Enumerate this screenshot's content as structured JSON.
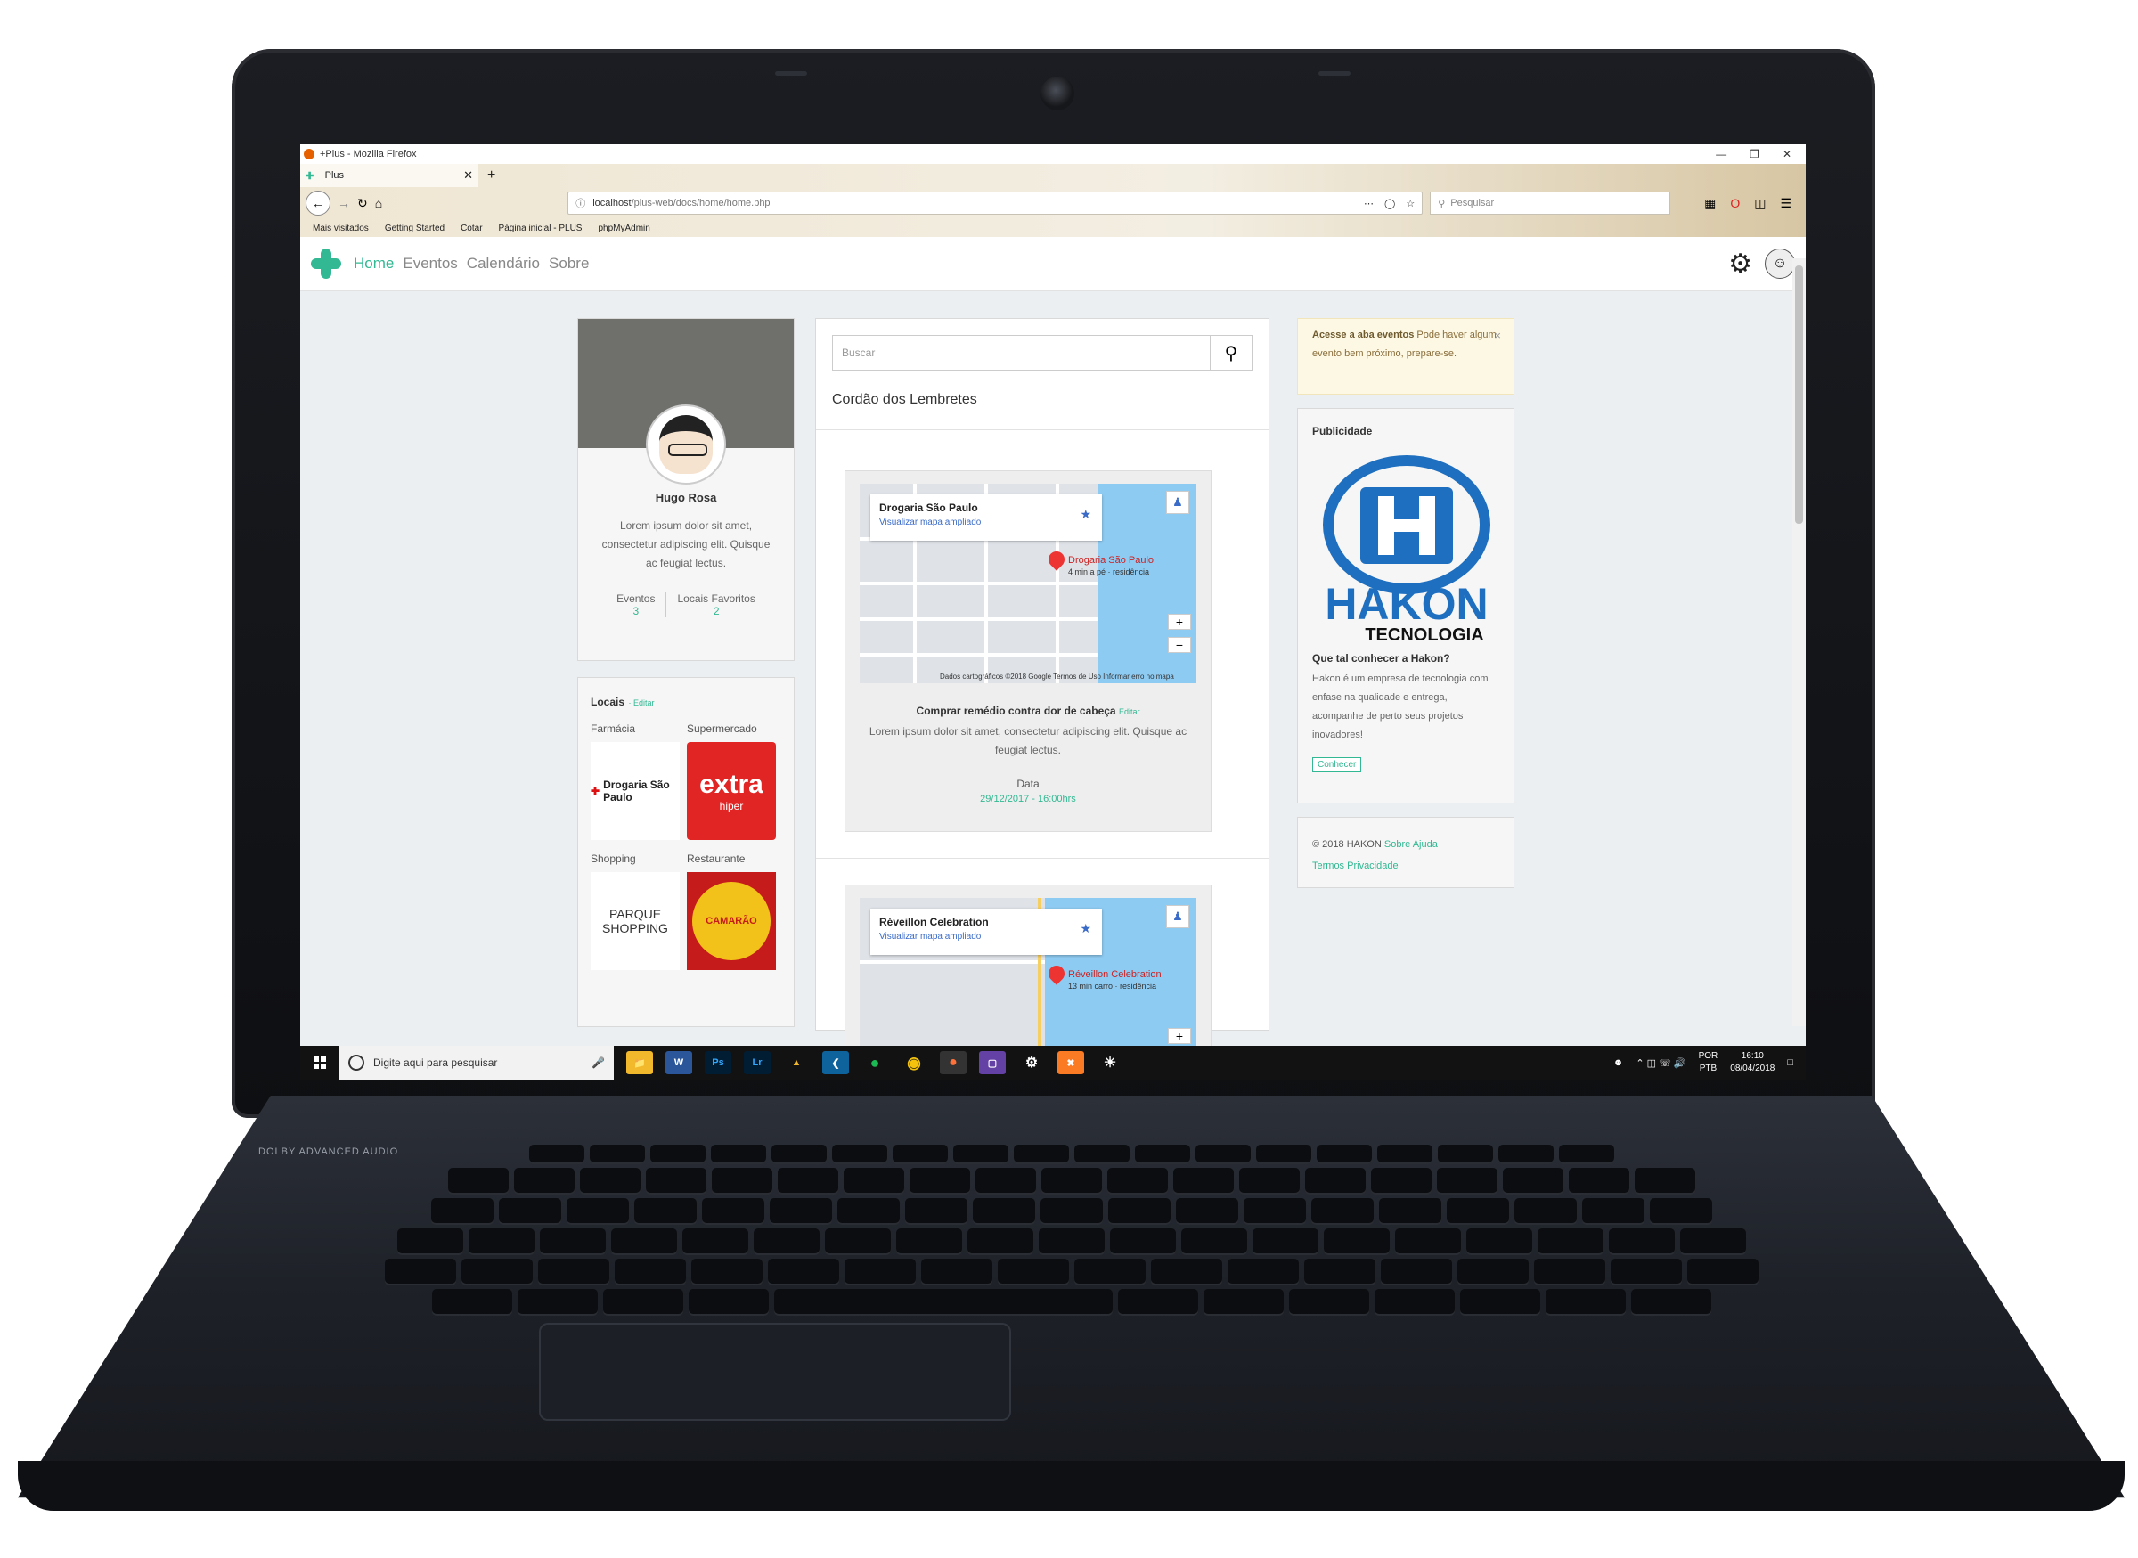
{
  "browser": {
    "window_title": "+Plus - Mozilla Firefox",
    "tab_title": "+Plus",
    "url_prefix": "localhost",
    "url_rest": "/plus-web/docs/home/home.php",
    "search_placeholder": "Pesquisar",
    "bookmarks": [
      "Mais visitados",
      "Getting Started",
      "Cotar",
      "Página inicial - PLUS",
      "phpMyAdmin"
    ]
  },
  "site": {
    "nav": [
      "Home",
      "Eventos",
      "Calendário",
      "Sobre"
    ]
  },
  "profile": {
    "name": "Hugo Rosa",
    "bio": "Lorem ipsum dolor sit amet, consectetur adipiscing elit. Quisque ac feugiat lectus.",
    "stats": [
      {
        "label": "Eventos",
        "value": "3"
      },
      {
        "label": "Locais Favoritos",
        "value": "2"
      }
    ]
  },
  "places": {
    "title": "Locais",
    "edit": "· Editar",
    "items": [
      {
        "category": "Farmácia",
        "logo_text": "Drogaria São Paulo"
      },
      {
        "category": "Supermercado",
        "logo_text": "extra",
        "logo_sub": "hiper"
      },
      {
        "category": "Shopping",
        "logo_text": "PARQUE SHOPPING"
      },
      {
        "category": "Restaurante",
        "logo_text": "CAMARÃO"
      }
    ]
  },
  "feed": {
    "search_placeholder": "Buscar",
    "title": "Cordão dos Lembretes",
    "reminders": [
      {
        "map_place": "Drogaria São Paulo",
        "map_link": "Visualizar mapa ampliado",
        "pin_label": "Drogaria São Paulo",
        "pin_sub": "4 min a pé · residência",
        "map_footer": "Dados cartográficos ©2018 Google   Termos de Uso   Informar erro no mapa",
        "title": "Comprar remédio contra dor de cabeça",
        "edit": "Editar",
        "desc": "Lorem ipsum dolor sit amet, consectetur adipiscing elit. Quisque ac feugiat lectus.",
        "date_label": "Data",
        "date": "29/12/2017 - 16:00hrs"
      },
      {
        "map_place": "Réveillon Celebration",
        "map_link": "Visualizar mapa ampliado",
        "pin_label": "Réveillon Celebration",
        "pin_sub": "13 min carro · residência"
      }
    ]
  },
  "alert": {
    "strong": "Acesse a aba eventos",
    "text": " Pode haver algum evento bem próximo, prepare-se.",
    "close": "×"
  },
  "ad": {
    "title": "Publicidade",
    "brand": "HAKON",
    "brand_sub": "TECNOLOGIA",
    "question": "Que tal conhecer a Hakon?",
    "desc": "Hakon é um empresa de tecnologia com enfase na qualidade e entrega, acompanhe de perto seus projetos inovadores!",
    "button": "Conhecer"
  },
  "footer": {
    "copyright": "© 2018 HAKON",
    "links": [
      "Sobre",
      "Ajuda",
      "Termos",
      "Privacidade"
    ]
  },
  "taskbar": {
    "search": "Digite aqui para pesquisar",
    "lang1": "POR",
    "lang2": "PTB",
    "time": "16:10",
    "date": "08/04/2018"
  },
  "laptop": {
    "brand_label": "DOLBY  ADVANCED AUDIO"
  }
}
